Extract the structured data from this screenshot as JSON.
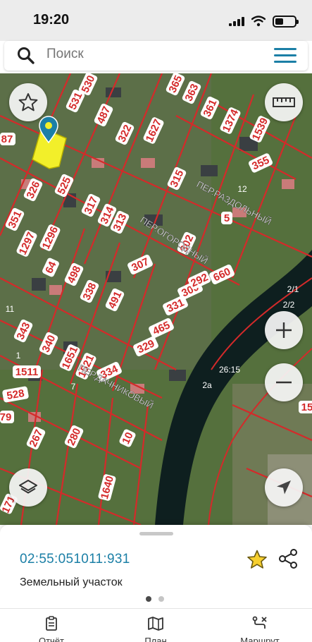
{
  "status_bar": {
    "time": "19:20"
  },
  "search": {
    "placeholder": "Поиск"
  },
  "map": {
    "parcel_numbers": [
      "531",
      "530",
      "365",
      "363",
      "361",
      "1374",
      "1539",
      "355",
      "487",
      "322",
      "1627",
      "315",
      "326",
      "525",
      "317",
      "314",
      "313",
      "351",
      "1297",
      "1296",
      "64",
      "498",
      "338",
      "491",
      "307",
      "331",
      "300",
      "465",
      "329",
      "343",
      "340",
      "1651",
      "1521",
      "334",
      "1511",
      "528",
      "267",
      "280",
      "1640",
      "660",
      "292",
      "302",
      "87",
      "12",
      "5",
      "79",
      "1",
      "11",
      "2/1",
      "2/2",
      "26:15",
      "2a",
      "171",
      "10",
      "7",
      "15"
    ],
    "street_labels": [
      "ПЕР.РАЗДОЛЬНЫЙ",
      "ПЕР.ОГОРОДНЫЙ",
      "ПЕР.ДАЧНИКОВЫЙ"
    ]
  },
  "colors": {
    "parcel_border": "#d42a2a",
    "accent": "#1b7fa6",
    "selected_parcel": "#f2ef2a"
  },
  "selected": {
    "cadastral_number": "02:55:051011:931",
    "object_type": "Земельный участок"
  },
  "tabs": [
    {
      "label": "Отчёт",
      "icon": "report-icon"
    },
    {
      "label": "План",
      "icon": "map-plan-icon"
    },
    {
      "label": "Маршрут",
      "icon": "route-icon"
    }
  ]
}
